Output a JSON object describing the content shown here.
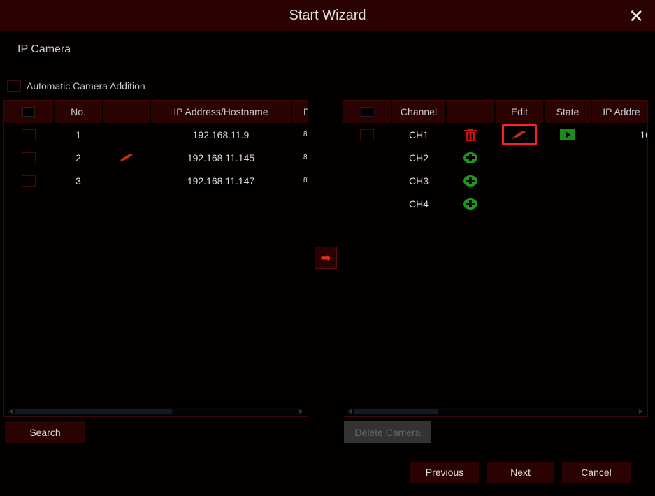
{
  "window": {
    "title": "Start Wizard",
    "close_icon": "close-icon"
  },
  "section_title": "IP Camera",
  "auto_add": {
    "label": "Automatic Camera Addition",
    "checked": false
  },
  "left_table": {
    "headers": [
      "",
      "No.",
      "",
      "IP Address/Hostname",
      "P"
    ],
    "rows": [
      {
        "no": "1",
        "ip": "192.168.11.9",
        "port": "8",
        "edit": false
      },
      {
        "no": "2",
        "ip": "192.168.11.145",
        "port": "8",
        "edit": true
      },
      {
        "no": "3",
        "ip": "192.168.11.147",
        "port": "8",
        "edit": false
      }
    ]
  },
  "right_table": {
    "headers": [
      "",
      "Channel",
      "",
      "Edit",
      "State",
      "IP Addre"
    ],
    "rows": [
      {
        "channel": "CH1",
        "action": "trash-icon",
        "edit": true,
        "state": "play-icon",
        "ip": "10",
        "checkbox": true
      },
      {
        "channel": "CH2",
        "action": "add-icon",
        "edit": false,
        "state": "",
        "ip": "",
        "checkbox": false
      },
      {
        "channel": "CH3",
        "action": "add-icon",
        "edit": false,
        "state": "",
        "ip": "",
        "checkbox": false
      },
      {
        "channel": "CH4",
        "action": "add-icon",
        "edit": false,
        "state": "",
        "ip": "",
        "checkbox": false
      }
    ]
  },
  "buttons": {
    "search": "Search",
    "delete_camera": "Delete Camera",
    "previous": "Previous",
    "next": "Next",
    "cancel": "Cancel"
  },
  "colors": {
    "accent": "#2a0202",
    "highlight": "#ff2020",
    "add": "#1c9a1c",
    "delete": "#d01010",
    "edit": "#c03010"
  }
}
